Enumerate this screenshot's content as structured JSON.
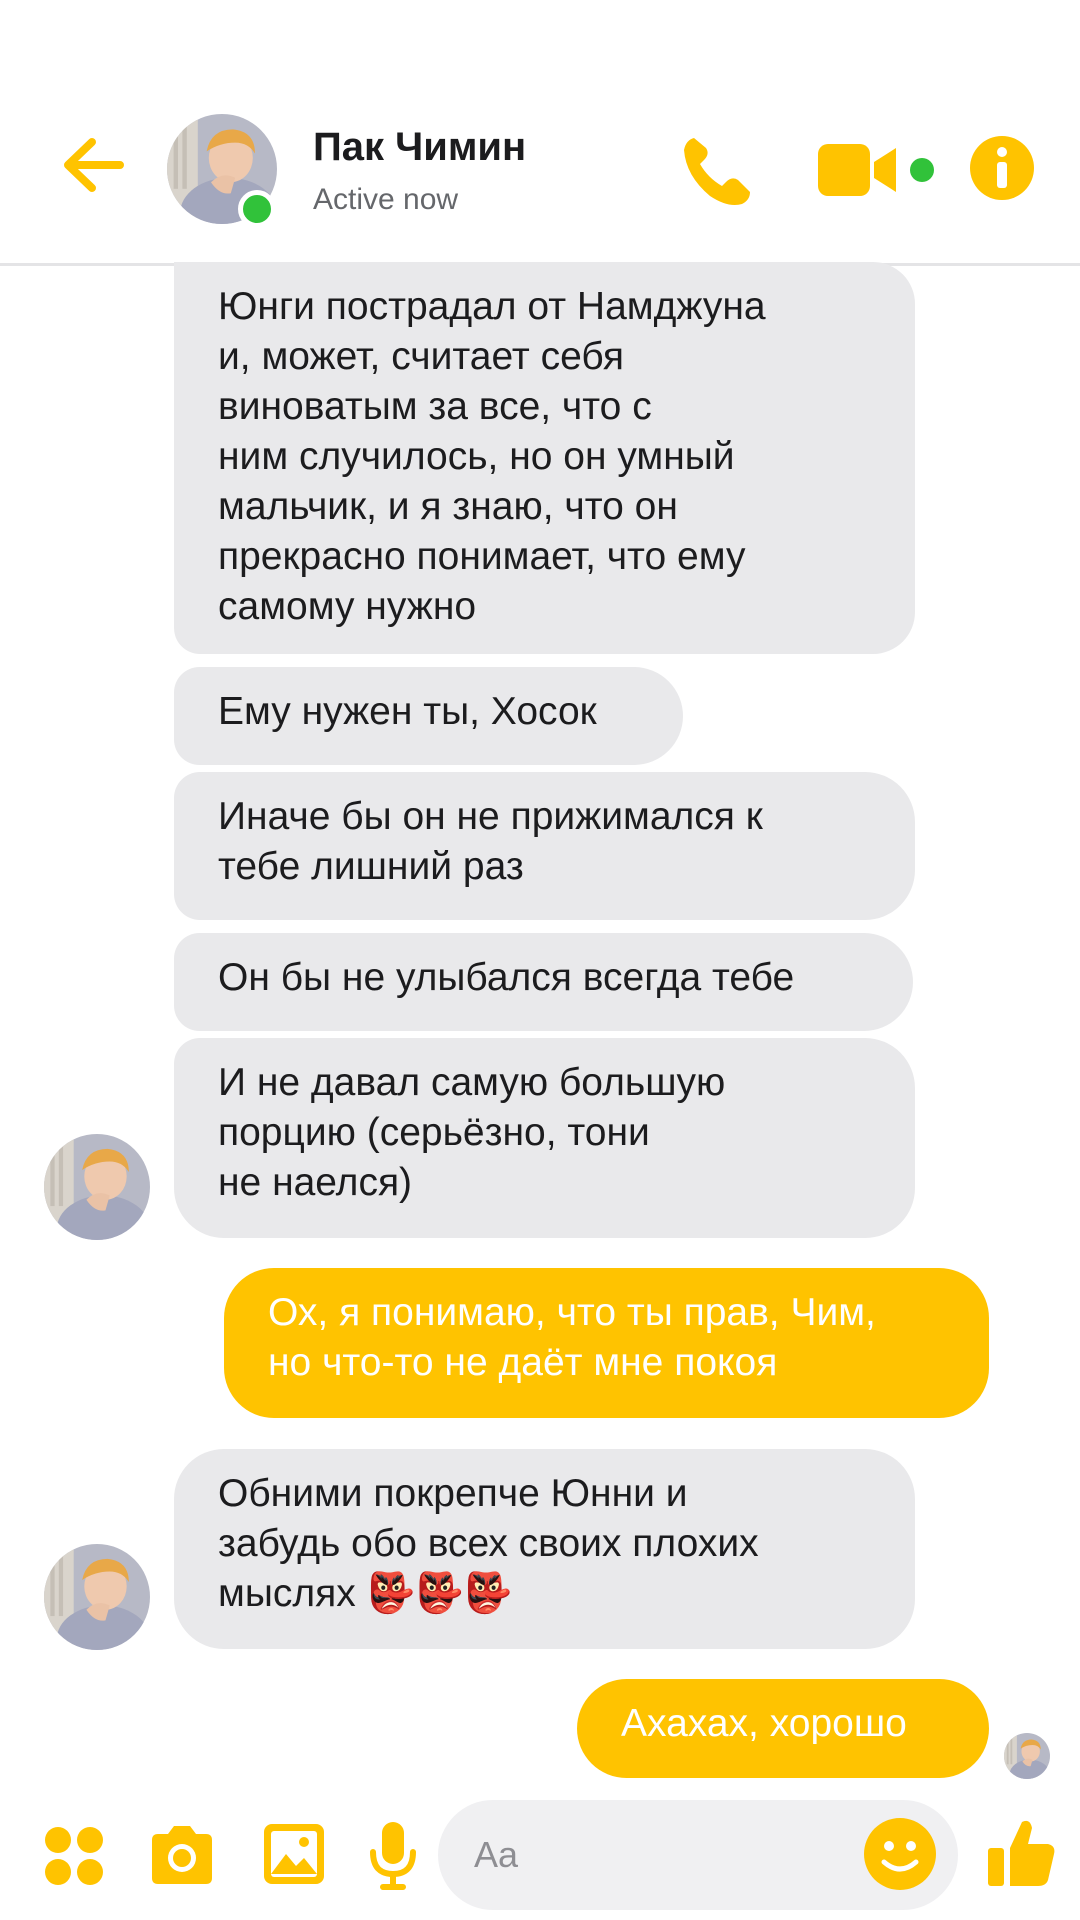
{
  "header": {
    "contact_name": "Пак Чимин",
    "status": "Active now"
  },
  "messages": [
    {
      "direction": "incoming",
      "text": "Юнги пострадал от Намджуна\nи, может, считает себя\nвиноватым за все, что с\nним случилось, но он умный\nмальчик, и я знаю, что он\nпрекрасно понимает, что ему\nсамому нужно"
    },
    {
      "direction": "incoming",
      "text": "Ему нужен ты, Хосок"
    },
    {
      "direction": "incoming",
      "text": "Иначе бы он не прижимался к\nтебе лишний раз"
    },
    {
      "direction": "incoming",
      "text": "Он бы не улыбался всегда тебе"
    },
    {
      "direction": "incoming",
      "text": "И не давал самую большую\nпорцию (серьёзно, тони\nне наелся)"
    },
    {
      "direction": "outgoing",
      "text": "Ох, я понимаю, что ты прав, Чим,\nно что-то не даёт мне покоя"
    },
    {
      "direction": "incoming",
      "text": "Обними покрепче Юнни и\nзабудь обо всех своих плохих\nмыслях 👺👺👺"
    },
    {
      "direction": "outgoing",
      "text": "Ахахах, хорошо"
    }
  ],
  "composer": {
    "placeholder": "Aa"
  },
  "icons": {
    "back": "arrow-left-icon",
    "call": "phone-icon",
    "video": "video-camera-icon",
    "info": "info-icon",
    "apps": "four-dots-icon",
    "camera": "camera-icon",
    "gallery": "image-icon",
    "voice": "microphone-icon",
    "emoji": "smiley-icon",
    "like": "thumbs-up-icon"
  },
  "colors": {
    "accent": "#ffc300",
    "incoming_bubble": "#e9e9eb",
    "online": "#31c23a"
  }
}
